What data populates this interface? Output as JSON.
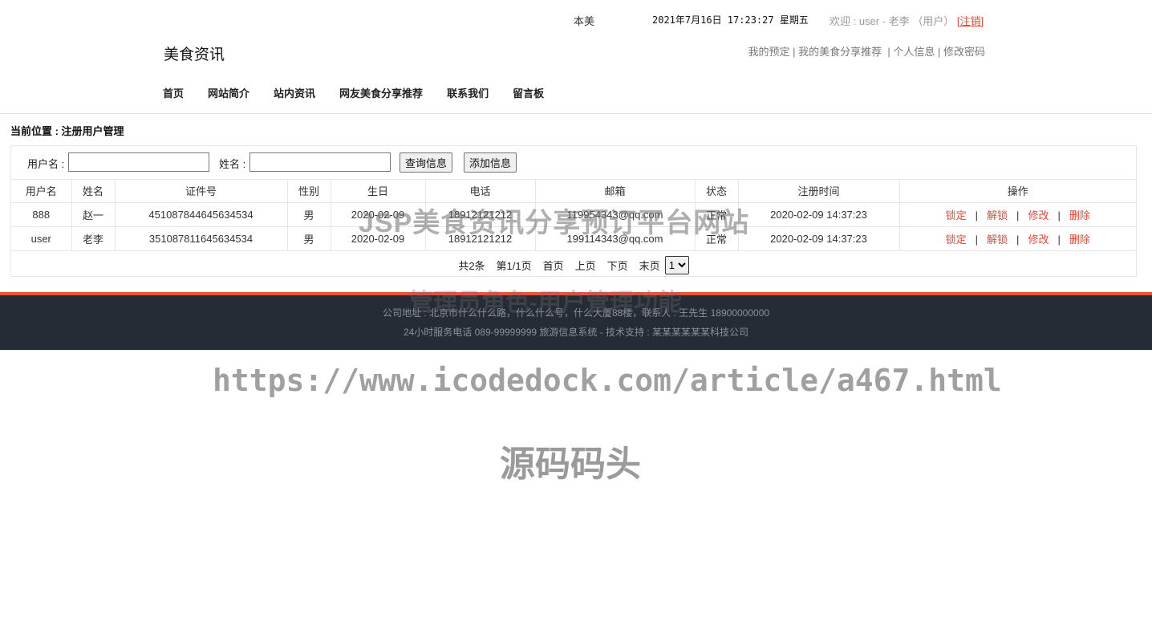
{
  "topbar": {
    "marquee": "本美",
    "datetime": "2021年7月16日 17:23:27 星期五",
    "welcome": "欢迎 : user - 老李 （用户）",
    "logout": "[注销]"
  },
  "brand": "美食资讯",
  "user_links": [
    "我的预定",
    "我的美食分享推荐",
    "个人信息",
    "修改密码"
  ],
  "nav": [
    "首页",
    "网站简介",
    "站内资讯",
    "网友美食分享推荐",
    "联系我们",
    "留言板"
  ],
  "breadcrumb": "当前位置 : 注册用户管理",
  "search": {
    "username_label": "用户名 :",
    "username_value": "",
    "name_label": "姓名 :",
    "name_value": "",
    "query_button": "查询信息",
    "add_button": "添加信息"
  },
  "table": {
    "headers": [
      "用户名",
      "姓名",
      "证件号",
      "性别",
      "生日",
      "电话",
      "邮箱",
      "状态",
      "注册时间",
      "操作"
    ],
    "rows": [
      {
        "username": "888",
        "name": "赵一",
        "id_no": "451087844645634534",
        "gender": "男",
        "birthday": "2020-02-09",
        "phone": "18912121212",
        "email": "119954343@qq.com",
        "status": "正常",
        "reg_time": "2020-02-09 14:37:23"
      },
      {
        "username": "user",
        "name": "老李",
        "id_no": "351087811645634534",
        "gender": "男",
        "birthday": "2020-02-09",
        "phone": "18912121212",
        "email": "199114343@qq.com",
        "status": "正常",
        "reg_time": "2020-02-09 14:37:23"
      }
    ],
    "actions": {
      "lock": "锁定",
      "unlock": "解锁",
      "edit": "修改",
      "delete": "删除",
      "separator": "|"
    }
  },
  "pager": {
    "total": "共2条",
    "page_info": "第1/1页",
    "first": "首页",
    "prev": "上页",
    "next": "下页",
    "last": "末页",
    "selected_page": "1"
  },
  "footer": {
    "line1": "公司地址 : 北京市什么什么路，什么什么号，什么大厦88楼，联系人 : 王先生 18900000000",
    "line2": "24小时服务电话   089-99999999   旅游信息系统 - 技术支持 : 某某某某某某科技公司"
  },
  "watermarks": {
    "title": "JSP美食资讯分享预订平台网站",
    "subtitle": "管理员角色-用户管理功能",
    "url": "https://www.icodedock.com/article/a467.html",
    "site": "源码码头"
  },
  "colors": {
    "accent": "#e0493a",
    "footer_bg": "#252c35"
  }
}
